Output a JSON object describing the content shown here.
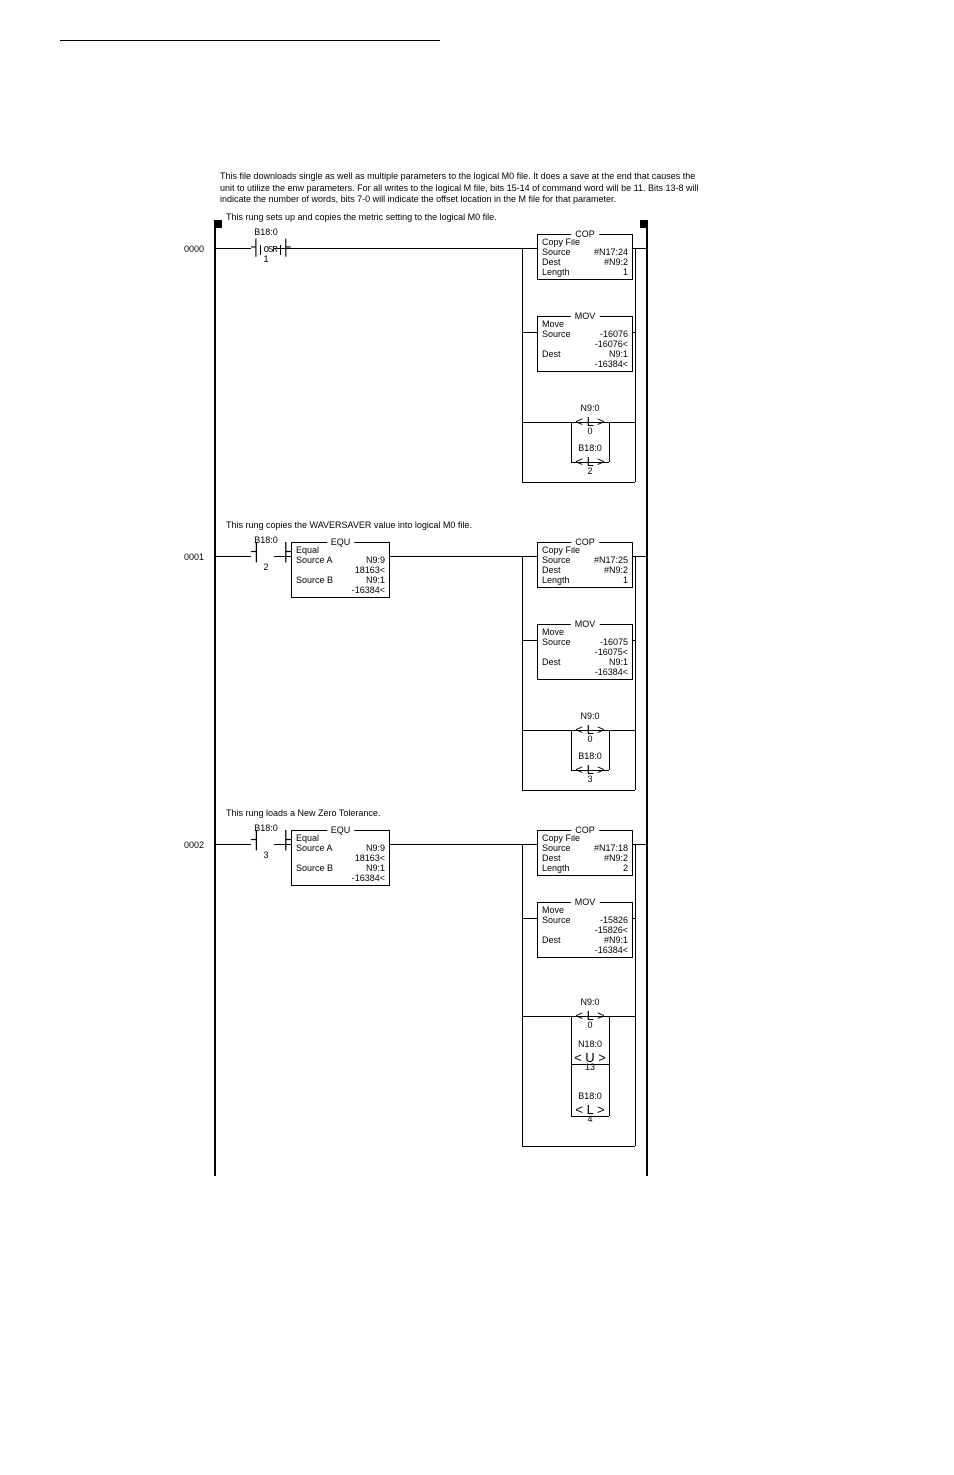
{
  "intro": "This file downloads single as well as multiple parameters to the logical M0 file. It does a save at the end that causes the unit to utilize the enw parameters. For all writes to the logical M file, bits 15-14 of command word will be 11. Bits 13-8 will indicate the number of words, bits 7-0 will indicate the offset location in the M file for that parameter.",
  "labels": {
    "source": "Source",
    "dest": "Dest",
    "length": "Length",
    "sourceA": "Source A",
    "sourceB": "Source B"
  },
  "rung0": {
    "num": "0000",
    "desc": "This rung sets up and copies the metric setting to the logical M0 file.",
    "osr": {
      "addr": "B18:0",
      "label": "OSR",
      "bit": "1"
    },
    "cop": {
      "title": "COP",
      "name": "Copy File",
      "source": "#N17:24",
      "dest": "#N9:2",
      "length": "1"
    },
    "mov": {
      "title": "MOV",
      "name": "Move",
      "source": "-16076",
      "sourceVal": "-16076<",
      "dest": "N9:1",
      "destVal": "-16384<"
    },
    "out1": {
      "addr": "N9:0",
      "bit": "0"
    },
    "out2": {
      "addr": "B18:0",
      "bit": "2"
    }
  },
  "rung1": {
    "num": "0001",
    "desc": "This rung copies the WAVERSAVER value into logical M0 file.",
    "xic": {
      "addr": "B18:0",
      "bit": "2"
    },
    "equ": {
      "title": "EQU",
      "name": "Equal",
      "sourceA": "N9:9",
      "sourceAVal": "18163<",
      "sourceB": "N9:1",
      "sourceBVal": "-16384<"
    },
    "cop": {
      "title": "COP",
      "name": "Copy File",
      "source": "#N17:25",
      "dest": "#N9:2",
      "length": "1"
    },
    "mov": {
      "title": "MOV",
      "name": "Move",
      "source": "-16075",
      "sourceVal": "-16075<",
      "dest": "N9:1",
      "destVal": "-16384<"
    },
    "out1": {
      "addr": "N9:0",
      "bit": "0"
    },
    "out2": {
      "addr": "B18:0",
      "bit": "3"
    }
  },
  "rung2": {
    "num": "0002",
    "desc": "This rung loads a New Zero Tolerance.",
    "xic": {
      "addr": "B18:0",
      "bit": "3"
    },
    "equ": {
      "title": "EQU",
      "name": "Equal",
      "sourceA": "N9:9",
      "sourceAVal": "18163<",
      "sourceB": "N9:1",
      "sourceBVal": "-16384<"
    },
    "cop": {
      "title": "COP",
      "name": "Copy File",
      "source": "#N17:18",
      "dest": "#N9:2",
      "length": "2"
    },
    "mov": {
      "title": "MOV",
      "name": "Move",
      "source": "-15826",
      "sourceVal": "-15826<",
      "dest": "#N9:1",
      "destVal": "-16384<"
    },
    "out1": {
      "addr": "N9:0",
      "bit": "0"
    },
    "out2": {
      "addr": "N18:0",
      "bit": "13"
    },
    "out3": {
      "addr": "B18:0",
      "bit": "4"
    }
  }
}
